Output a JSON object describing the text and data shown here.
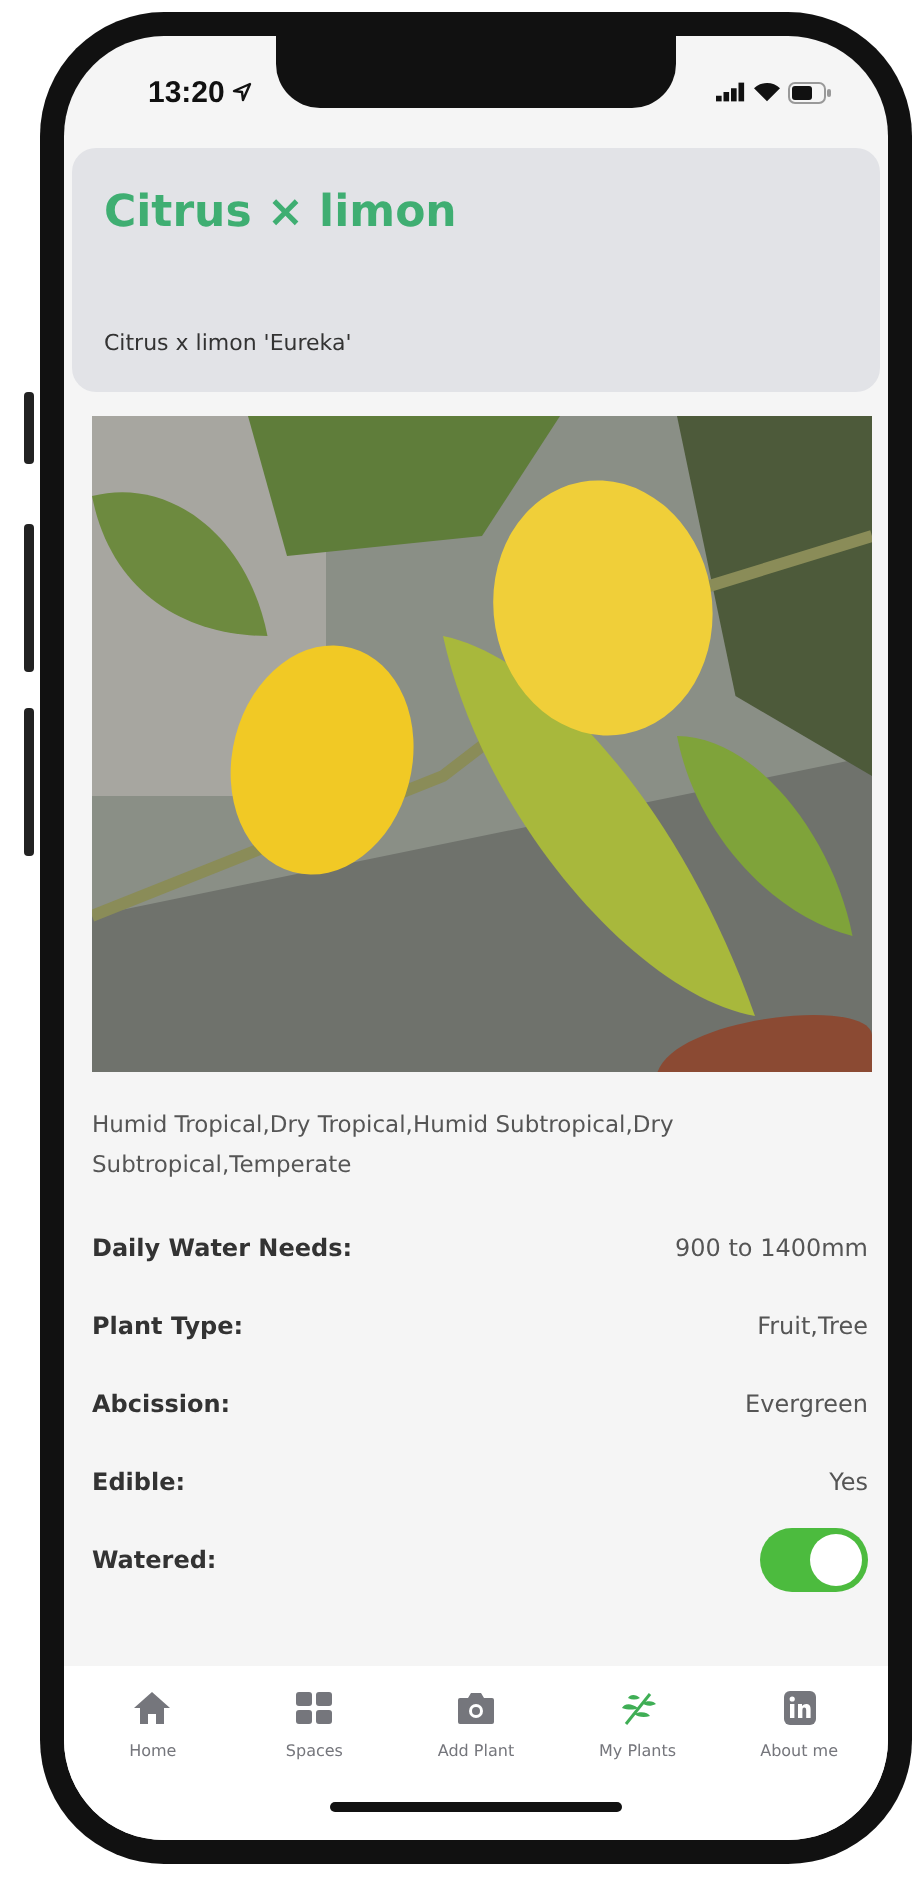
{
  "status_bar": {
    "time": "13:20"
  },
  "header": {
    "title": "Citrus × limon",
    "subtitle": "Citrus x limon 'Eureka'"
  },
  "climates": "Humid Tropical,Dry Tropical,Humid Subtropical,Dry Subtropical,Temperate",
  "details": [
    {
      "kind": "text",
      "label": "Daily Water Needs:",
      "value": "900 to 1400mm"
    },
    {
      "kind": "text",
      "label": "Plant Type:",
      "value": "Fruit,Tree"
    },
    {
      "kind": "text",
      "label": "Abcission:",
      "value": "Evergreen"
    },
    {
      "kind": "text",
      "label": "Edible:",
      "value": "Yes"
    },
    {
      "kind": "toggle",
      "label": "Watered:",
      "on": true
    }
  ],
  "tabs": [
    {
      "label": "Home",
      "selected": false
    },
    {
      "label": "Spaces",
      "selected": false
    },
    {
      "label": "Add Plant",
      "selected": false
    },
    {
      "label": "My Plants",
      "selected": true
    },
    {
      "label": "About me",
      "selected": false
    }
  ]
}
